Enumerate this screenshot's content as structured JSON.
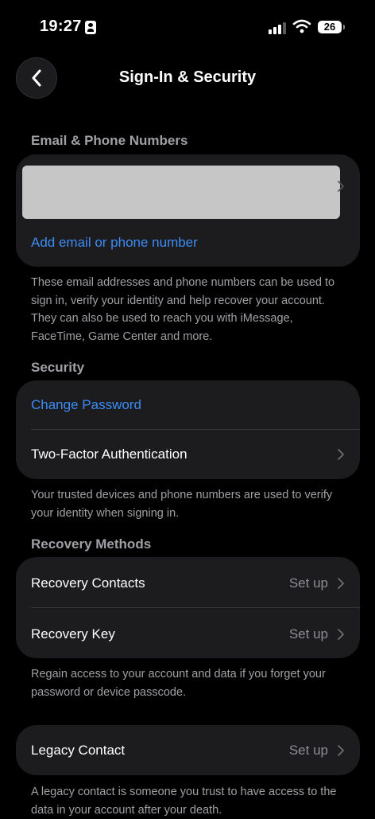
{
  "status_bar": {
    "time": "19:27",
    "battery": "26"
  },
  "nav": {
    "title": "Sign-In & Security"
  },
  "email_section": {
    "header": "Email & Phone Numbers",
    "add_label": "Add email or phone number",
    "footer": "These email addresses and phone numbers can be used to sign in, verify your identity and help recover your account. They can also be used to reach you with iMessage, FaceTime, Game Center and more."
  },
  "security_section": {
    "header": "Security",
    "change_password": "Change Password",
    "two_factor": "Two-Factor Authentication",
    "footer": "Your trusted devices and phone numbers are used to verify your identity when signing in."
  },
  "recovery_section": {
    "header": "Recovery Methods",
    "contacts_label": "Recovery Contacts",
    "contacts_value": "Set up",
    "key_label": "Recovery Key",
    "key_value": "Set up",
    "footer": "Regain access to your account and data if you forget your password or device passcode."
  },
  "legacy_section": {
    "label": "Legacy Contact",
    "value": "Set up",
    "footer": "A legacy contact is someone you trust to have access to the data in your account after your death."
  },
  "colors": {
    "accent": "#3b8cf5",
    "background": "#000000",
    "card": "#1c1c1e"
  }
}
